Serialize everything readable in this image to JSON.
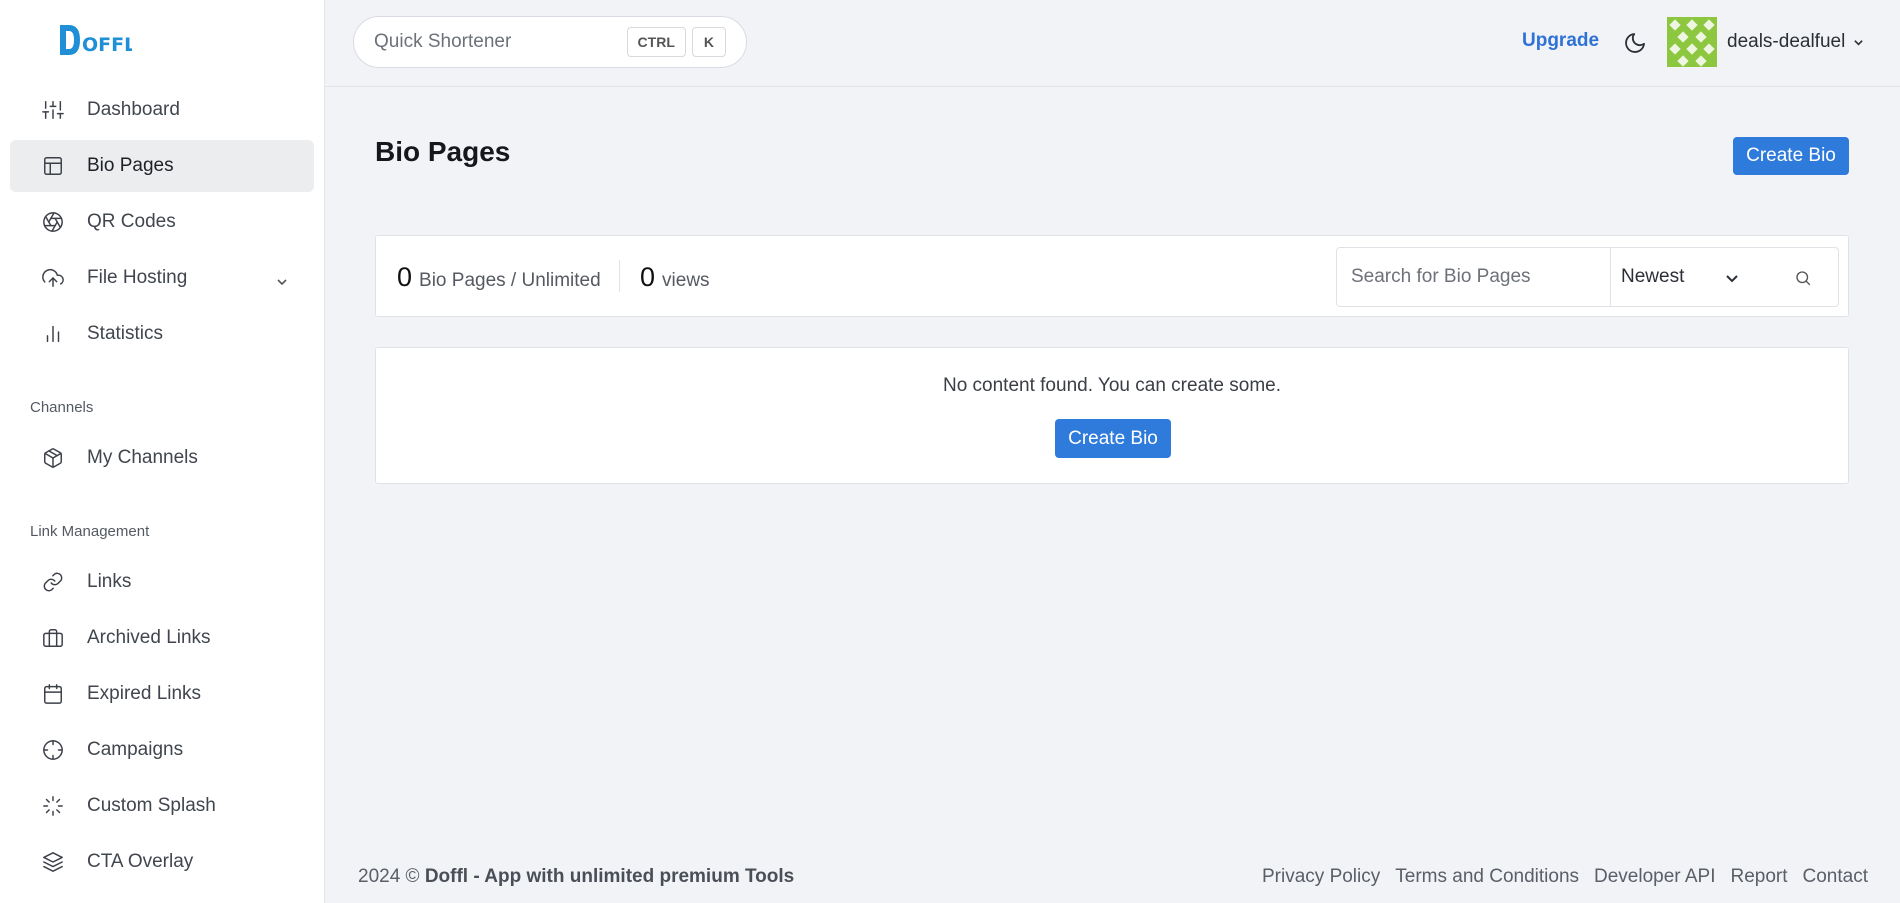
{
  "brand": {
    "logo_text": "DOFFL",
    "accent": "#2f7bdc"
  },
  "sidebar": {
    "items": [
      {
        "label": "Dashboard",
        "icon": "sliders-icon"
      },
      {
        "label": "Bio Pages",
        "icon": "layout-icon",
        "active": true
      },
      {
        "label": "QR Codes",
        "icon": "aperture-icon"
      },
      {
        "label": "File Hosting",
        "icon": "upload-cloud-icon",
        "has_submenu": true
      },
      {
        "label": "Statistics",
        "icon": "bar-chart-icon"
      }
    ],
    "sections": [
      {
        "title": "Channels",
        "items": [
          {
            "label": "My Channels",
            "icon": "box-icon"
          }
        ]
      },
      {
        "title": "Link Management",
        "items": [
          {
            "label": "Links",
            "icon": "link-icon"
          },
          {
            "label": "Archived Links",
            "icon": "briefcase-icon"
          },
          {
            "label": "Expired Links",
            "icon": "calendar-icon"
          },
          {
            "label": "Campaigns",
            "icon": "crosshair-icon"
          },
          {
            "label": "Custom Splash",
            "icon": "loader-icon"
          },
          {
            "label": "CTA Overlay",
            "icon": "layers-icon"
          }
        ]
      }
    ]
  },
  "topbar": {
    "quick_placeholder": "Quick Shortener",
    "kbd_ctrl": "CTRL",
    "kbd_k": "K",
    "upgrade_label": "Upgrade",
    "username": "deals-dealfuel"
  },
  "main": {
    "title": "Bio Pages",
    "create_label": "Create Bio",
    "stats": {
      "bio_count": "0",
      "bio_label": "Bio Pages / Unlimited",
      "views_count": "0",
      "views_label": "views"
    },
    "search_placeholder": "Search for Bio Pages",
    "sort_selected": "Newest",
    "empty_message": "No content found. You can create some.",
    "empty_create_label": "Create Bio"
  },
  "footer": {
    "year": "2024 ©",
    "brand_text": "Doffl - App with unlimited premium Tools",
    "links": [
      "Privacy Policy",
      "Terms and Conditions",
      "Developer API",
      "Report",
      "Contact"
    ]
  }
}
